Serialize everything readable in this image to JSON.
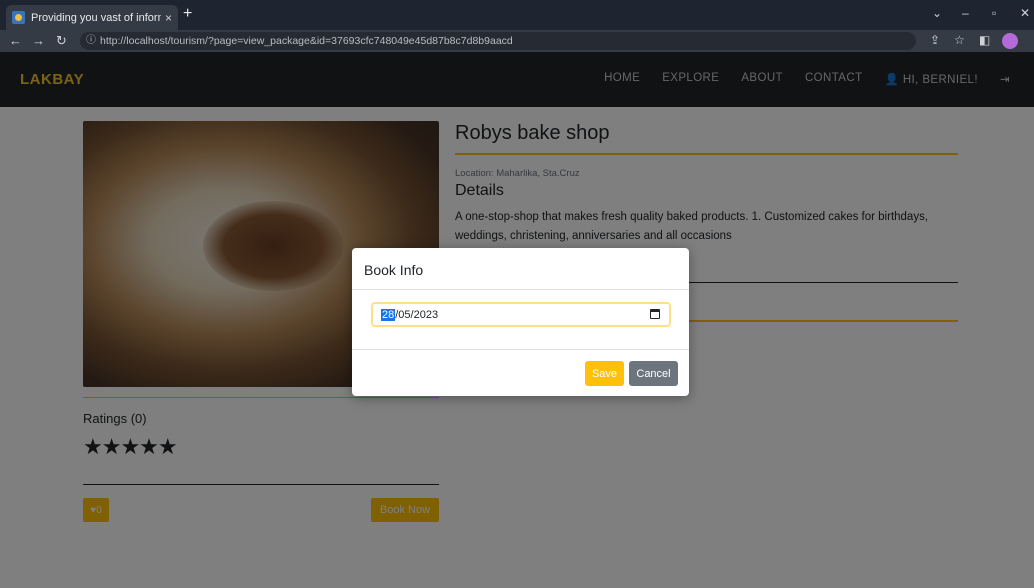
{
  "browser": {
    "tab_title": "Providing you vast of informatio",
    "tab_close": "×",
    "new_tab": "+",
    "url_host": "http://localhost",
    "url_path": "/tourism/?page=view_package&id=37693cfc748049e45d87b8c7d8b9aacd"
  },
  "site": {
    "brand": "LAKBAY",
    "nav": [
      "HOME",
      "EXPLORE",
      "ABOUT",
      "CONTACT",
      "HI, BERNIEL!"
    ]
  },
  "place": {
    "title": "Robys bake shop",
    "location": "Location: Maharlika, Sta.Cruz",
    "details_heading": "Details",
    "description": "A one-stop-shop that makes fresh quality baked products. 1. Customized cakes for birthdays, weddings, christening, anniversaries and all occasions"
  },
  "ratings": {
    "label": "Ratings (0)",
    "stars": "★★★★★",
    "like_count": "0",
    "book_button": "Book Now"
  },
  "modal": {
    "title": "Book Info",
    "date_day": "28",
    "date_rest": "/05/2023",
    "save": "Save",
    "cancel": "Cancel"
  },
  "colors": {
    "accent": "#ffc107",
    "navbar": "#212529",
    "secondary": "#6c757d"
  }
}
